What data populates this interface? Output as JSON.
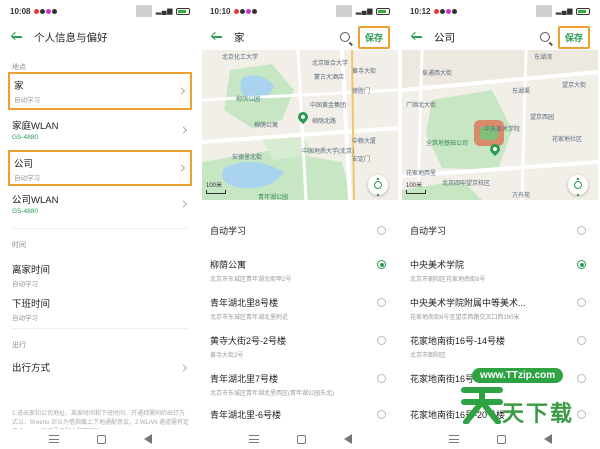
{
  "panel1": {
    "status": {
      "time": "10:08"
    },
    "title": "个人信息与偏好",
    "section_place": "地点",
    "home": {
      "name": "家",
      "sub": "自动学习"
    },
    "home_wlan": {
      "name": "家庭WLAN",
      "sub": "GS-4880"
    },
    "work": {
      "name": "公司",
      "sub": "自动学习"
    },
    "work_wlan": {
      "name": "公司WLAN",
      "sub": "GS-4880"
    },
    "section_time": "时间",
    "leave_home": {
      "name": "离家时间",
      "sub": "自动学习"
    },
    "off_work": {
      "name": "下班时间",
      "sub": "自动学习"
    },
    "section_travel": "出行",
    "travel_mode": {
      "name": "出行方式"
    },
    "footnote": "1.进出家和公司地址、离家时间和下班时间、开通拜需同的出行方式以、Breeno 识以为借指载上下地通配意议。2.WLAN 通道需有定于 Breeno 更识通根配上和下班时。"
  },
  "panel2": {
    "status": {
      "time": "10:10"
    },
    "title": "家",
    "save_label": "保存",
    "map": {
      "scale": "100米",
      "labels": [
        "北京化工大学",
        "北京联合大学",
        "黄寺大街",
        "柳荫公园",
        "德胜门",
        "蒙古大酒店",
        "中国黄金集团",
        "柳荫公寓",
        "安德里北街",
        "青年湖公园",
        "柳荫北路",
        "中国地质大学(北京)",
        "安定门",
        "中粮大厦"
      ]
    },
    "auto_learn": "自动学习",
    "pois": [
      {
        "name": "柳荫公寓",
        "addr": "北京市东城区青年湖北街甲2号",
        "selected": true
      },
      {
        "name": "青年湖北里8号楼",
        "addr": "北京市东城区青年湖北里附近",
        "selected": false
      },
      {
        "name": "黄寺大街2号-2号楼",
        "addr": "黄寺大街2号",
        "selected": false
      },
      {
        "name": "青年湖北里7号楼",
        "addr": "北京市东城区青年湖北里西区(青年湖公园东北)",
        "selected": false
      },
      {
        "name": "青年湖北里-6号楼",
        "addr": "",
        "selected": false
      }
    ]
  },
  "panel3": {
    "status": {
      "time": "10:12"
    },
    "title": "公司",
    "save_label": "保存",
    "map": {
      "scale": "100米",
      "labels": [
        "阜通西大街",
        "东湖湾",
        "望京大街",
        "广顺北大街",
        "中央美术学院",
        "东湖渠",
        "望京西园",
        "花家地社区",
        "全筑地基础公司",
        "北京四中望京校区",
        "花家地西里",
        "方舟苑"
      ]
    },
    "auto_learn": "自动学习",
    "pois": [
      {
        "name": "中央美术学院",
        "addr": "北京市朝阳区花家地南街8号",
        "selected": true
      },
      {
        "name": "中央美术学院附属中等美术...",
        "addr": "花家地南街8号至望京西路交叉口西190米",
        "selected": false
      },
      {
        "name": "花家地南街16号-14号楼",
        "addr": "北京市朝阳区",
        "selected": false
      },
      {
        "name": "花家地南街16号-14号楼",
        "addr": "",
        "selected": false
      },
      {
        "name": "花家地南街16号-20号楼",
        "addr": "",
        "selected": false
      }
    ]
  },
  "watermark": {
    "url": "www.TTzip.com",
    "big_char": "天",
    "text": "天下载"
  }
}
